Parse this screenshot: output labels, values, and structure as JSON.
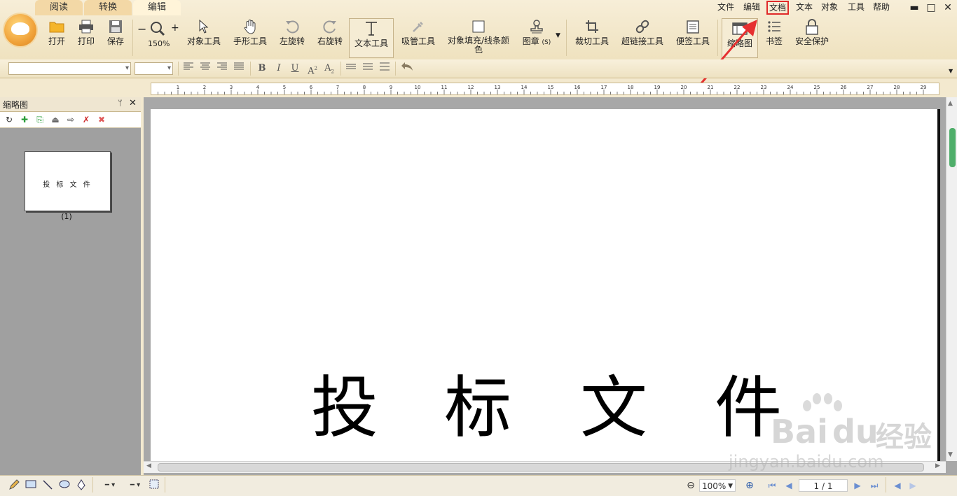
{
  "tabs": [
    "阅读",
    "转换",
    "编辑"
  ],
  "menu": [
    "文件",
    "编辑",
    "文档",
    "文本",
    "对象",
    "工具",
    "帮助"
  ],
  "highlighted_menu": "文档",
  "window_controls": {
    "minimize": "▬",
    "maximize": "□",
    "close": "✕"
  },
  "toolbar": {
    "open": "打开",
    "print": "打印",
    "save": "保存",
    "zoom_out": "−",
    "zoom_in": "+",
    "zoom": "150%",
    "object_tool": "对象工具",
    "hand_tool": "手形工具",
    "rotate_left": "左旋转",
    "rotate_right": "右旋转",
    "text_tool": "文本工具",
    "eyedropper": "吸管工具",
    "fill_line": "对象填充/线条颜色",
    "stamp": "图章",
    "stamp_key": "(S)",
    "crop": "裁切工具",
    "hyperlink": "超链接工具",
    "note": "便签工具",
    "thumbnail": "缩略图",
    "bookmark": "书签",
    "security": "安全保护"
  },
  "ruler": {
    "labels": [
      "1",
      "2",
      "3",
      "4",
      "5",
      "6",
      "7",
      "8",
      "9",
      "10",
      "11",
      "12",
      "13",
      "14",
      "15",
      "16",
      "17",
      "18",
      "19",
      "20",
      "21",
      "22",
      "23",
      "24",
      "25",
      "26",
      "27",
      "28",
      "29"
    ]
  },
  "panel": {
    "title": "缩略图",
    "pin": "ᛘ",
    "close": "✕",
    "thumb_text": "投 标 文 件",
    "thumb_label": "(1)"
  },
  "document": {
    "chars": [
      "投",
      "标",
      "文",
      "件"
    ]
  },
  "status": {
    "zoom": "100%",
    "page": "1 / 1"
  },
  "watermark": {
    "brand": "Bai",
    "brand2": "du",
    "tag": "经验",
    "url": "jingyan.baidu.com"
  },
  "colors": {
    "highlight": "#e02a2a",
    "scroll_thumb": "#4fae6a"
  }
}
